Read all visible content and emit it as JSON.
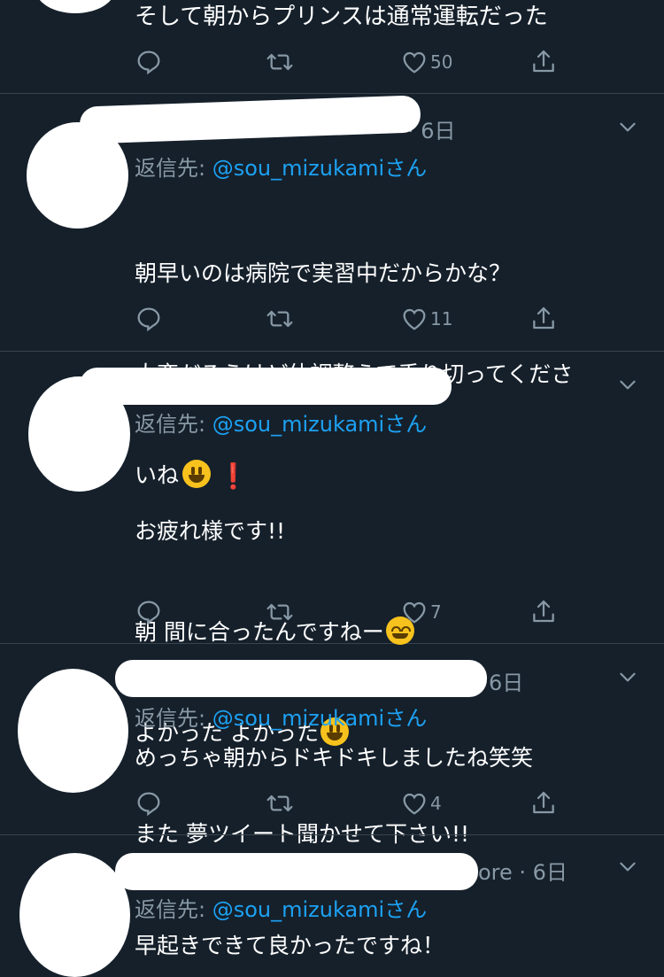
{
  "tweets": [
    {
      "header": "",
      "reply_prefix": "",
      "handle": "",
      "reply_suffix": "",
      "body": "そして朝からプリンスは通常運転だった",
      "likes": "50"
    },
    {
      "header": "· 6日",
      "reply_prefix": "返信先: ",
      "handle": "@sou_mizukami",
      "reply_suffix": "さん",
      "body_lines": [
        "朝早いのは病院で実習中だからかな？",
        "大変だろうけど体調整えて乗り切ってくださ",
        "いね"
      ],
      "likes": "11"
    },
    {
      "header": "",
      "reply_prefix": "返信先: ",
      "handle": "@sou_mizukami",
      "reply_suffix": "さん",
      "body_lines": [
        "お疲れ様です!!",
        "朝 間に合ったんですねー",
        "よかった よかった",
        "また 夢ツイート聞かせて下さい!!"
      ],
      "likes": "7"
    },
    {
      "header": "6日",
      "reply_prefix": "返信先: ",
      "handle": "@sou_mizukami",
      "reply_suffix": "さん",
      "body": "めっちゃ朝からドキドキしましたね笑笑",
      "likes": "4"
    },
    {
      "header": "ore · 6日",
      "reply_prefix": "返信先: ",
      "handle": "@sou_mizukami",
      "reply_suffix": "さん",
      "body": "早起きできて良かったですね！"
    }
  ],
  "icons": {
    "reply": "reply-icon",
    "retweet": "retweet-icon",
    "like": "heart-icon",
    "share": "share-icon",
    "more": "chevron-down-icon"
  },
  "colors": {
    "background": "#15202b",
    "divider": "#38444d",
    "secondary_text": "#8899a6",
    "link": "#1da1f2"
  }
}
